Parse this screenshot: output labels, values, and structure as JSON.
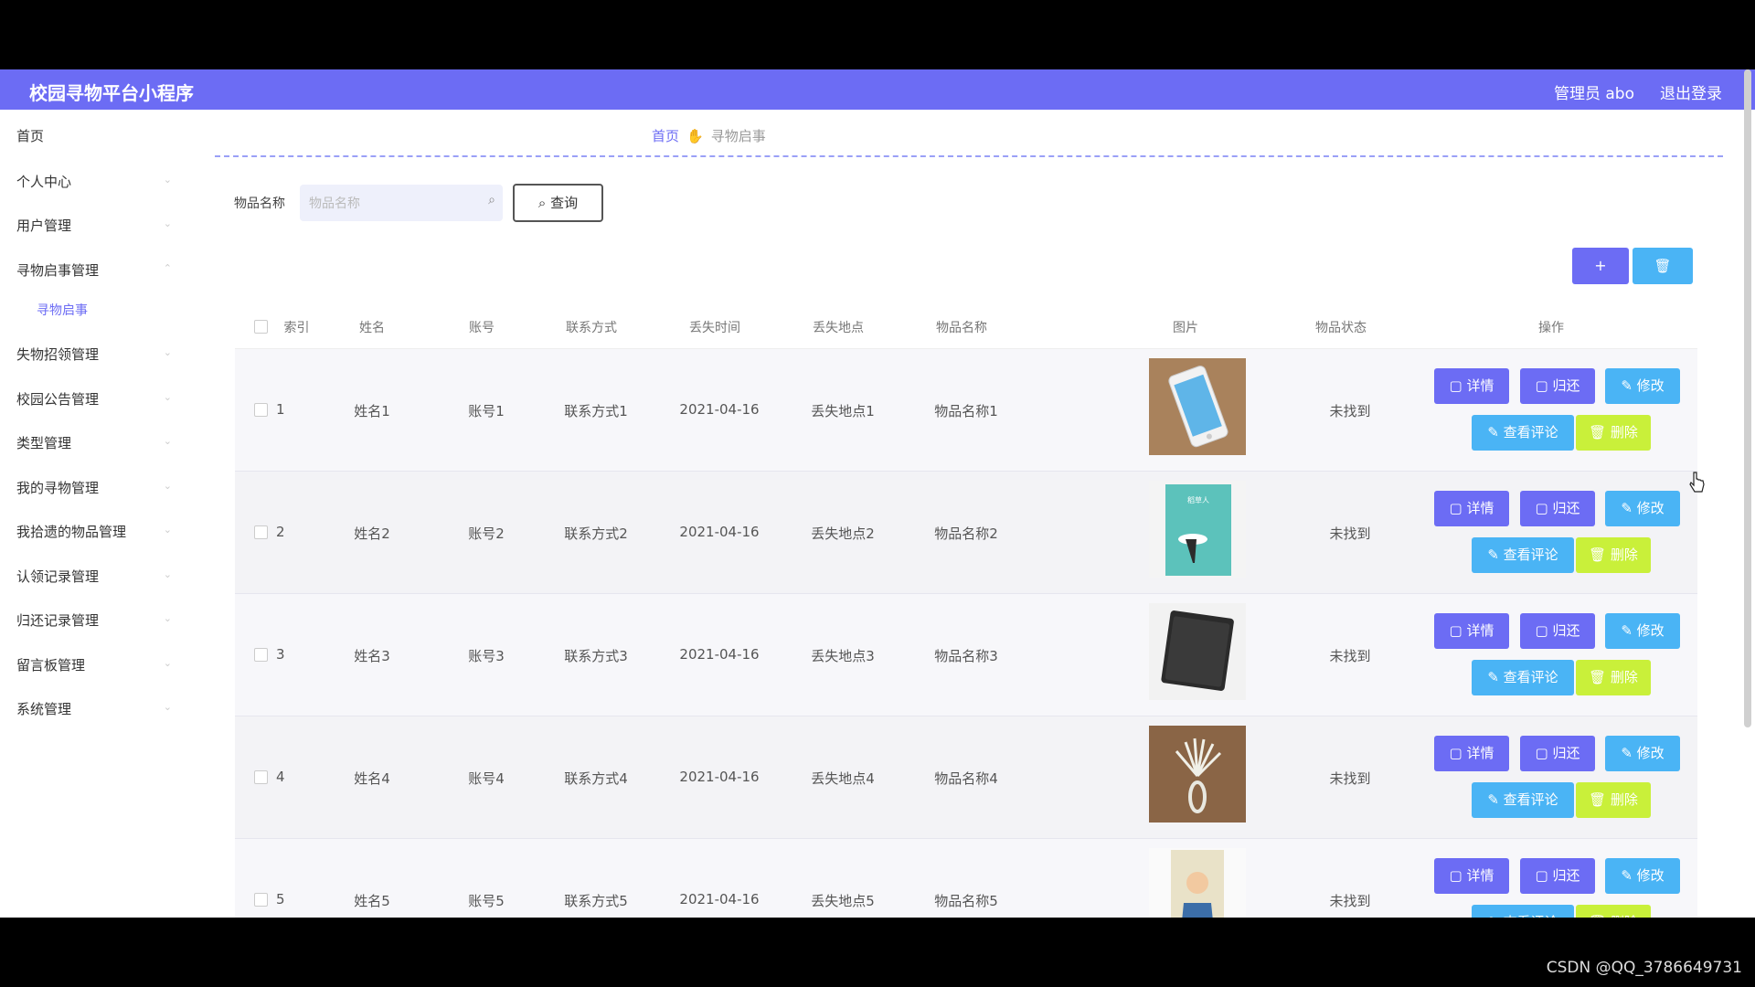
{
  "header": {
    "title": "校园寻物平台小程序",
    "user": "管理员 abo",
    "logout": "退出登录"
  },
  "sidebar": {
    "items": [
      {
        "label": "首页"
      },
      {
        "label": "个人中心"
      },
      {
        "label": "用户管理"
      },
      {
        "label": "寻物启事管理"
      },
      {
        "label": "寻物启事"
      },
      {
        "label": "失物招领管理"
      },
      {
        "label": "校园公告管理"
      },
      {
        "label": "类型管理"
      },
      {
        "label": "我的寻物管理"
      },
      {
        "label": "我拾遗的物品管理"
      },
      {
        "label": "认领记录管理"
      },
      {
        "label": "归还记录管理"
      },
      {
        "label": "留言板管理"
      },
      {
        "label": "系统管理"
      }
    ]
  },
  "breadcrumb": {
    "home": "首页",
    "current": "寻物启事"
  },
  "search": {
    "label": "物品名称",
    "placeholder": "物品名称",
    "button": "查询"
  },
  "toolbar": {
    "add": "+",
    "delete": "🗑"
  },
  "table": {
    "headers": [
      "索引",
      "姓名",
      "账号",
      "联系方式",
      "丢失时间",
      "丢失地点",
      "物品名称",
      "图片",
      "物品状态",
      "操作"
    ],
    "rows": [
      {
        "index": "1",
        "name": "姓名1",
        "account": "账号1",
        "contact": "联系方式1",
        "time": "2021-04-16",
        "place": "丢失地点1",
        "item": "物品名称1",
        "status": "未找到"
      },
      {
        "index": "2",
        "name": "姓名2",
        "account": "账号2",
        "contact": "联系方式2",
        "time": "2021-04-16",
        "place": "丢失地点2",
        "item": "物品名称2",
        "status": "未找到"
      },
      {
        "index": "3",
        "name": "姓名3",
        "account": "账号3",
        "contact": "联系方式3",
        "time": "2021-04-16",
        "place": "丢失地点3",
        "item": "物品名称3",
        "status": "未找到"
      },
      {
        "index": "4",
        "name": "姓名4",
        "account": "账号4",
        "contact": "联系方式4",
        "time": "2021-04-16",
        "place": "丢失地点4",
        "item": "物品名称4",
        "status": "未找到"
      },
      {
        "index": "5",
        "name": "姓名5",
        "account": "账号5",
        "contact": "联系方式5",
        "time": "2021-04-16",
        "place": "丢失地点5",
        "item": "物品名称5",
        "status": "未找到"
      }
    ],
    "actions": {
      "detail": "详情",
      "return": "归还",
      "edit": "修改",
      "comment": "查看评论",
      "delete": "删除"
    }
  },
  "watermark": "CSDN @QQ_3786649731",
  "colors": {
    "primary": "#6c6cf4",
    "info": "#4ab4f5",
    "warning": "#c9f03a"
  }
}
